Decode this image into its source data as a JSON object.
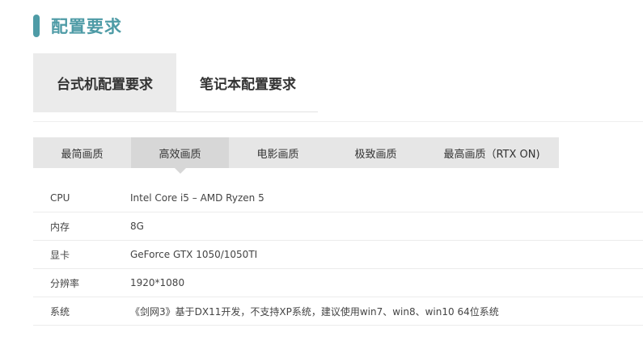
{
  "section": {
    "title": "配置要求",
    "accent_color": "#4e9ba6"
  },
  "main_tabs": [
    {
      "label": "台式机配置要求",
      "active": true
    },
    {
      "label": "笔记本配置要求",
      "active": false
    }
  ],
  "quality_tabs": [
    {
      "label": "最简画质",
      "active": false
    },
    {
      "label": "高效画质",
      "active": true
    },
    {
      "label": "电影画质",
      "active": false
    },
    {
      "label": "极致画质",
      "active": false
    },
    {
      "label": "最高画质（RTX ON)",
      "active": false
    }
  ],
  "specs": [
    {
      "label": "CPU",
      "value": "Intel Core i5 – AMD Ryzen 5"
    },
    {
      "label": "内存",
      "value": "8G"
    },
    {
      "label": "显卡",
      "value": "GeForce GTX 1050/1050TI"
    },
    {
      "label": "分辨率",
      "value": "1920*1080"
    },
    {
      "label": "系统",
      "value": "《剑网3》基于DX11开发，不支持XP系统，建议使用win7、win8、win10 64位系统"
    }
  ]
}
